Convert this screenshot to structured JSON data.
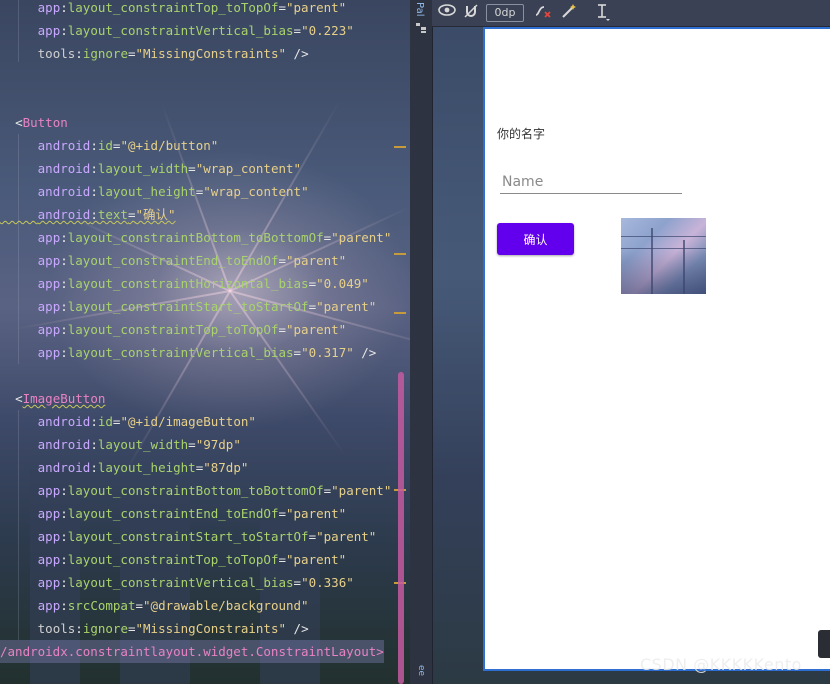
{
  "editor": {
    "closing_tag": "/androidx.constraintlayout.widget.ConstraintLayout>",
    "lines": {
      "l1": {
        "ns": "app",
        "sep": ":",
        "attr": "layout_constraintTop_toTopOf",
        "eq": "=",
        "val": "\"parent\""
      },
      "l2": {
        "ns": "app",
        "sep": ":",
        "attr": "layout_constraintVertical_bias",
        "eq": "=",
        "val": "\"0.223\""
      },
      "l3": {
        "ns": "tools",
        "sep": ":",
        "attr": "ignore",
        "eq": "=",
        "val": "\"MissingConstraints\"",
        "end": " />"
      },
      "b_open": {
        "lt": "<",
        "tag": "Button"
      },
      "b1": {
        "ns": "android",
        "sep": ":",
        "attr": "id",
        "eq": "=",
        "val": "\"@+id/button\""
      },
      "b2": {
        "ns": "android",
        "sep": ":",
        "attr": "layout_width",
        "eq": "=",
        "val": "\"wrap_content\""
      },
      "b3": {
        "ns": "android",
        "sep": ":",
        "attr": "layout_height",
        "eq": "=",
        "val": "\"wrap_content\""
      },
      "b4": {
        "ns": "android",
        "sep": ":",
        "attr": "text",
        "eq": "=",
        "val": "\"确认\""
      },
      "b5": {
        "ns": "app",
        "sep": ":",
        "attr": "layout_constraintBottom_toBottomOf",
        "eq": "=",
        "val": "\"parent\""
      },
      "b6": {
        "ns": "app",
        "sep": ":",
        "attr": "layout_constraintEnd_toEndOf",
        "eq": "=",
        "val": "\"parent\""
      },
      "b7": {
        "ns": "app",
        "sep": ":",
        "attr": "layout_constraintHorizontal_bias",
        "eq": "=",
        "val": "\"0.049\""
      },
      "b8": {
        "ns": "app",
        "sep": ":",
        "attr": "layout_constraintStart_toStartOf",
        "eq": "=",
        "val": "\"parent\""
      },
      "b9": {
        "ns": "app",
        "sep": ":",
        "attr": "layout_constraintTop_toTopOf",
        "eq": "=",
        "val": "\"parent\""
      },
      "b10": {
        "ns": "app",
        "sep": ":",
        "attr": "layout_constraintVertical_bias",
        "eq": "=",
        "val": "\"0.317\"",
        "end": " />"
      },
      "i_open": {
        "lt": "<",
        "tag": "ImageButton"
      },
      "i1": {
        "ns": "android",
        "sep": ":",
        "attr": "id",
        "eq": "=",
        "val": "\"@+id/imageButton\""
      },
      "i2": {
        "ns": "android",
        "sep": ":",
        "attr": "layout_width",
        "eq": "=",
        "val": "\"97dp\""
      },
      "i3": {
        "ns": "android",
        "sep": ":",
        "attr": "layout_height",
        "eq": "=",
        "val": "\"87dp\""
      },
      "i4": {
        "ns": "app",
        "sep": ":",
        "attr": "layout_constraintBottom_toBottomOf",
        "eq": "=",
        "val": "\"parent\""
      },
      "i5": {
        "ns": "app",
        "sep": ":",
        "attr": "layout_constraintEnd_toEndOf",
        "eq": "=",
        "val": "\"parent\""
      },
      "i6": {
        "ns": "app",
        "sep": ":",
        "attr": "layout_constraintStart_toStartOf",
        "eq": "=",
        "val": "\"parent\""
      },
      "i7": {
        "ns": "app",
        "sep": ":",
        "attr": "layout_constraintTop_toTopOf",
        "eq": "=",
        "val": "\"parent\""
      },
      "i8": {
        "ns": "app",
        "sep": ":",
        "attr": "layout_constraintVertical_bias",
        "eq": "=",
        "val": "\"0.336\""
      },
      "i9": {
        "ns": "app",
        "sep": ":",
        "attr": "srcCompat",
        "eq": "=",
        "val": "\"@drawable/background\""
      },
      "i10": {
        "ns": "tools",
        "sep": ":",
        "attr": "ignore",
        "eq": "=",
        "val": "\"MissingConstraints\"",
        "end": " />"
      }
    }
  },
  "design": {
    "palette_tab": "Pal",
    "toolbar": {
      "eye_icon": "eye-icon",
      "magnet_icon": "magnet-off-icon",
      "margin_value": "0dp",
      "clear_constraints_icon": "clear-constraints-icon",
      "infer_constraints_icon": "magic-wand-icon",
      "guidelines_icon": "guidelines-icon"
    },
    "preview": {
      "label_text": "你的名字",
      "input_placeholder": "Name",
      "button_label": "确认"
    }
  },
  "watermark": "CSDN @KKKKKento",
  "colors": {
    "primary_button": "#6200ee",
    "selection_border": "#2f6fd1",
    "xml_tag": "#e883c3",
    "xml_attr": "#a9d36c",
    "xml_string": "#e7d08a"
  }
}
